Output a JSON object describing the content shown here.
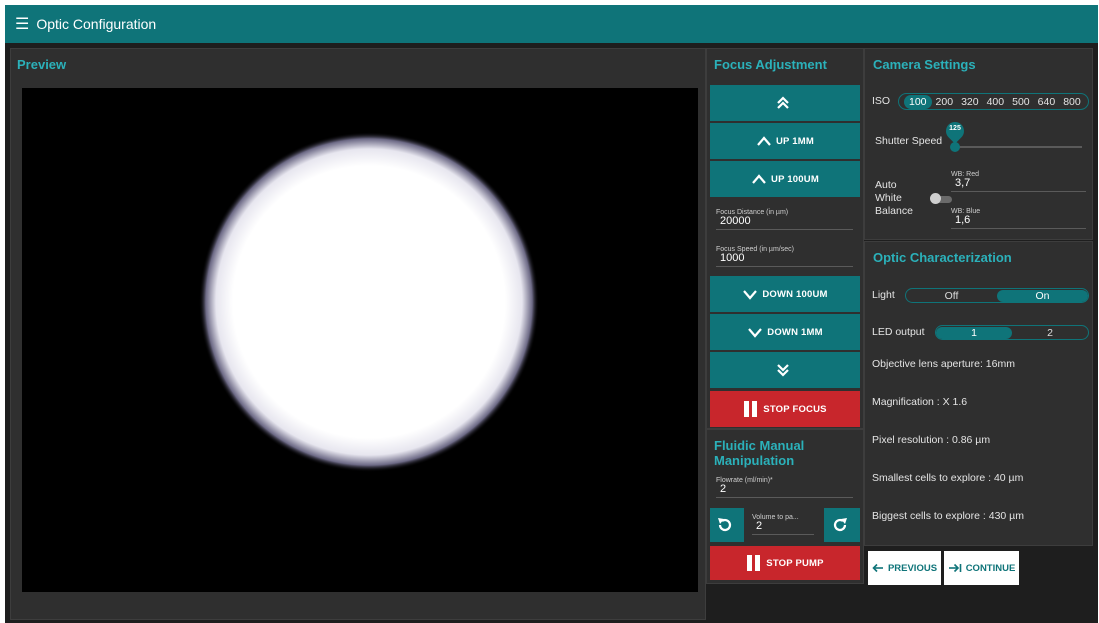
{
  "app": {
    "title": "Optic Configuration"
  },
  "preview": {
    "title": "Preview"
  },
  "focus": {
    "title": "Focus Adjustment",
    "up_1mm": "UP 1MM",
    "up_100um": "UP 100UM",
    "distance_label": "Focus Distance (in µm)",
    "distance_value": "20000",
    "speed_label": "Focus Speed (in µm/sec)",
    "speed_value": "1000",
    "down_100um": "DOWN 100UM",
    "down_1mm": "DOWN 1MM",
    "stop_focus": "STOP FOCUS"
  },
  "fluidic": {
    "title": "Fluidic Manual Manipulation",
    "flowrate_label": "Flowrate (ml/min)*",
    "flowrate_value": "2",
    "volume_label": "Volume to pa...",
    "volume_value": "2",
    "stop_pump": "STOP PUMP"
  },
  "camera": {
    "title": "Camera Settings",
    "iso_label": "ISO",
    "iso_options": [
      "100",
      "200",
      "320",
      "400",
      "500",
      "640",
      "800"
    ],
    "iso_selected": "100",
    "shutter_label": "Shutter Speed",
    "shutter_value": "125",
    "awb_label_1": "Auto",
    "awb_label_2": "White",
    "awb_label_3": "Balance",
    "awb_enabled": false,
    "wb_red_label": "WB: Red",
    "wb_red_value": "3,7",
    "wb_blue_label": "WB: Blue",
    "wb_blue_value": "1,6"
  },
  "optic": {
    "title": "Optic Characterization",
    "light_label": "Light",
    "light_off": "Off",
    "light_on": "On",
    "light_selected": "On",
    "led_label": "LED output",
    "led_1": "1",
    "led_2": "2",
    "led_selected": "1",
    "aperture": "Objective lens aperture: 16mm",
    "magnification": "Magnification : X 1.6",
    "pixel_res": "Pixel resolution : 0.86 µm",
    "smallest": "Smallest cells to explore : 40 µm",
    "biggest": "Biggest cells to explore : 430 µm"
  },
  "nav": {
    "previous": "PREVIOUS",
    "continue": "CONTINUE"
  },
  "colors": {
    "teal": "#0f7479",
    "accent_text": "#2bb1ba",
    "stop_red": "#c8262c",
    "panel_bg": "#2f2f2f",
    "app_bg": "#1e1e1e"
  }
}
